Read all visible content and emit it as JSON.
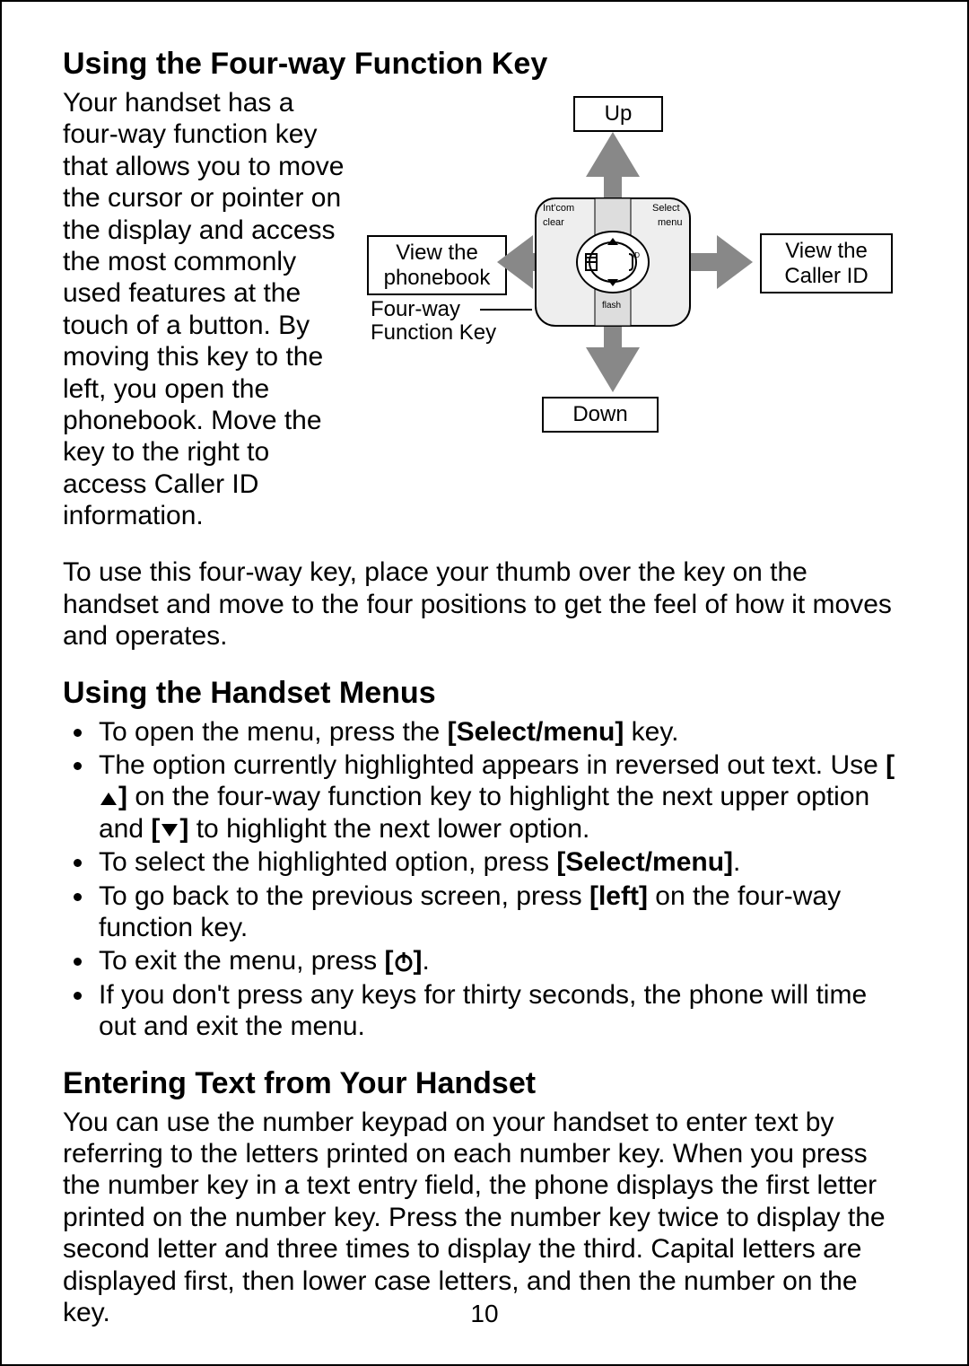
{
  "page_number": "10",
  "section1": {
    "heading": "Using the Four-way Function Key",
    "intro": "Your handset has a four-way function key that allows you to move the cursor or pointer on the display and access the most commonly used features at the touch of a button. By moving this key to the left, you open the phonebook. Move the key to the right to access Caller ID information.",
    "diagram": {
      "up_label": "Up",
      "down_label": "Down",
      "left_label_l1": "View the",
      "left_label_l2": "phonebook",
      "right_label_l1": "View the",
      "right_label_l2": "Caller ID",
      "fn_key_label_l1": "Four-way",
      "fn_key_label_l2": "Function Key",
      "dpad_top_left": "Int'com",
      "dpad_bottom_left": "clear",
      "dpad_top_right": "Select",
      "dpad_bottom_right": "menu",
      "dpad_center_bottom": "flash"
    },
    "para2": "To use this four-way key, place your thumb over the key on the handset and move to the four positions to get the feel of how it moves and operates."
  },
  "section2": {
    "heading": "Using the Handset Menus",
    "b1a": "To open the menu, press the ",
    "b1b_bold": "[Select/menu]",
    "b1c": " key.",
    "b2a": "The option currently highlighted appears in reversed out text. Use ",
    "b2b_bold": "[",
    "b2c": "]",
    "b2d": " on the four-way function key to highlight the next upper option and ",
    "b2e_bold": "[",
    "b2f": "]",
    "b2g": " to highlight the next lower option.",
    "b3a": "To select the highlighted option, press ",
    "b3b_bold": "[Select/menu]",
    "b3c": ".",
    "b4a": "To go back to the previous screen, press ",
    "b4b_bold": "[left]",
    "b4c": " on the four-way function key.",
    "b5a": "To exit the menu, press ",
    "b5b_bold": "[",
    "b5c": "]",
    "b5d": ".",
    "b6": "If you don't press any keys for thirty seconds, the phone will time out and exit the menu."
  },
  "section3": {
    "heading": "Entering Text from Your Handset",
    "para": "You can use the number keypad on your handset to enter text by referring to the letters printed on each number key. When you press the number key in a text entry field, the phone displays the first letter printed on the number key. Press the number key twice to display the second letter and three times to display the third. Capital letters are displayed first, then lower case letters, and then the number on the key."
  }
}
